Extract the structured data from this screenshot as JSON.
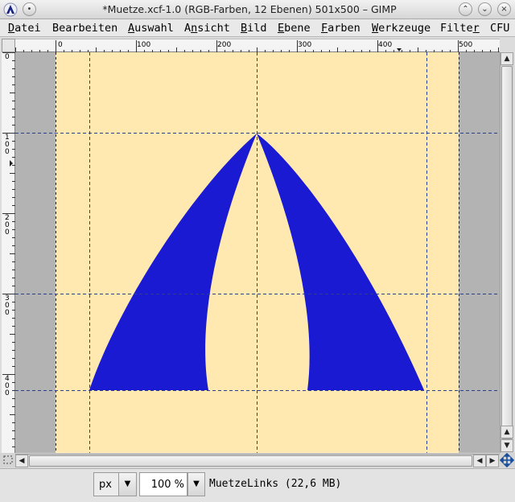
{
  "window": {
    "title": "*Muetze.xcf-1.0 (RGB-Farben, 12 Ebenen) 501x500 – GIMP",
    "app_icon": "wilber-icon",
    "controls": {
      "shade": "shade-icon",
      "minimize": "minimize-icon",
      "maximize": "maximize-icon",
      "close": "close-icon"
    },
    "menu_icon": "menu-circle-icon"
  },
  "menubar": {
    "items": [
      {
        "label": "Datei"
      },
      {
        "label": "Bearbeiten"
      },
      {
        "label": "Auswahl"
      },
      {
        "label": "Ansicht"
      },
      {
        "label": "Bild"
      },
      {
        "label": "Ebene"
      },
      {
        "label": "Farben"
      },
      {
        "label": "Werkzeuge"
      },
      {
        "label": "Filter"
      },
      {
        "label": "CFU"
      }
    ]
  },
  "rulers": {
    "horizontal_labels": [
      "0",
      "100",
      "200",
      "300",
      "400",
      "500"
    ],
    "vertical_labels": [
      "0",
      "100",
      "200",
      "300",
      "400"
    ]
  },
  "canvas": {
    "image_background": "#ffe9b0",
    "shape_color": "#1a1ad2",
    "guide_color": "#2d3f8a",
    "navigate_icon": "navigate-icon",
    "quick_mask_icon": "quick-mask-icon"
  },
  "statusbar": {
    "unit": "px",
    "zoom": "100 %",
    "message": "MuetzeLinks (22,6 MB)"
  }
}
